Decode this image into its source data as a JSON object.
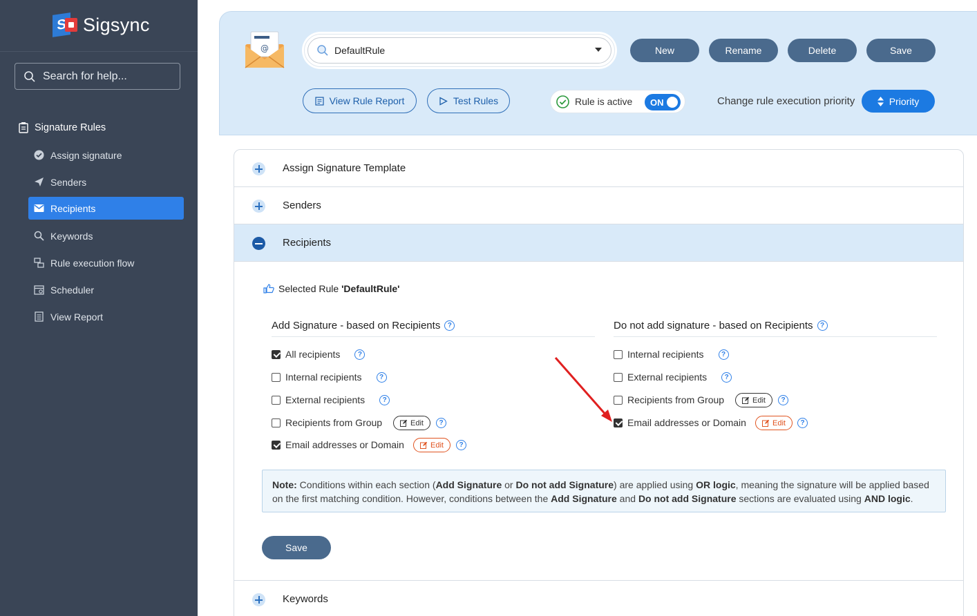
{
  "app": {
    "name": "Sigsync"
  },
  "sidebar": {
    "search_placeholder": "Search for help...",
    "section_title": "Signature Rules",
    "items": [
      {
        "label": "Assign signature",
        "icon": "check-circle-icon"
      },
      {
        "label": "Senders",
        "icon": "send-icon"
      },
      {
        "label": "Recipients",
        "icon": "mail-icon",
        "active": true
      },
      {
        "label": "Keywords",
        "icon": "search-icon"
      },
      {
        "label": "Rule execution flow",
        "icon": "flow-icon"
      },
      {
        "label": "Scheduler",
        "icon": "calendar-icon"
      },
      {
        "label": "View Report",
        "icon": "report-icon"
      }
    ]
  },
  "toolbar": {
    "rule_name": "DefaultRule",
    "new_label": "New",
    "rename_label": "Rename",
    "delete_label": "Delete",
    "save_label": "Save",
    "view_report_label": "View Rule Report",
    "test_rules_label": "Test Rules",
    "rule_active_label": "Rule is active",
    "toggle_label": "ON",
    "priority_text": "Change rule execution priority",
    "priority_label": "Priority"
  },
  "accordion": {
    "sections": [
      {
        "label": "Assign Signature Template",
        "open": false
      },
      {
        "label": "Senders",
        "open": false
      },
      {
        "label": "Recipients",
        "open": true
      },
      {
        "label": "Keywords",
        "open": false
      }
    ]
  },
  "recipients": {
    "selected_rule_prefix": "Selected Rule ",
    "selected_rule_name": "'DefaultRule'",
    "add_title": "Add Signature - based on Recipients",
    "noadd_title": "Do not add signature - based on Recipients",
    "edit_label": "Edit",
    "add_options": [
      {
        "label": "All recipients",
        "checked": true
      },
      {
        "label": "Internal recipients",
        "checked": false
      },
      {
        "label": "External recipients",
        "checked": false
      },
      {
        "label": "Recipients from Group",
        "checked": false
      },
      {
        "label": "Email addresses or Domain",
        "checked": true
      }
    ],
    "noadd_options": [
      {
        "label": "Internal recipients",
        "checked": false
      },
      {
        "label": "External recipients",
        "checked": false
      },
      {
        "label": "Recipients from Group",
        "checked": false
      },
      {
        "label": "Email addresses or Domain",
        "checked": true
      }
    ],
    "note": {
      "note_label": "Note:",
      "t1": " Conditions within each section (",
      "b1": "Add Signature",
      "t2": " or ",
      "b2": "Do not add Signature",
      "t3": ") are applied using ",
      "b3": "OR logic",
      "t4": ", meaning the signature will be applied based on the first matching condition. However, conditions between the ",
      "b4": "Add Signature",
      "t5": " and ",
      "b5": "Do not add Signature",
      "t6": " sections are evaluated using ",
      "b6": "AND logic",
      "t7": "."
    },
    "save_label": "Save"
  },
  "colors": {
    "sidebar_bg": "#3a4556",
    "accent": "#2f80e8",
    "panel_bg": "#d9eaf9",
    "button_slate": "#4a6a8d",
    "annotation_arrow": "#e02020"
  }
}
